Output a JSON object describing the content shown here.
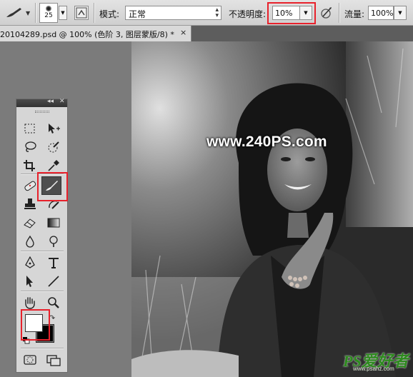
{
  "options_bar": {
    "brush_size": "25",
    "mode_label": "模式:",
    "mode_value": "正常",
    "opacity_label": "不透明度:",
    "opacity_value": "10%",
    "flow_label": "流量:",
    "flow_value": "100%"
  },
  "document_tab": {
    "title": "20104289.psd @ 100% (色阶 3, 图层蒙版/8) *",
    "close": "×"
  },
  "canvas": {
    "watermark": "www.240PS.com"
  },
  "site_logo": {
    "brand": "PS爱好者",
    "url": "www.psahz.com"
  },
  "tools_panel": {
    "collapse_glyph": "◂◂",
    "close_glyph": "✕",
    "foreground_color": "#ffffff",
    "background_color": "#000000",
    "tools": [
      "marquee-tool",
      "move-tool",
      "lasso-tool",
      "quick-selection-tool",
      "crop-tool",
      "eyedropper-tool",
      "healing-brush-tool",
      "brush-tool",
      "clone-stamp-tool",
      "history-brush-tool",
      "eraser-tool",
      "gradient-tool",
      "blur-tool",
      "dodge-tool",
      "pen-tool",
      "type-tool",
      "path-selection-tool",
      "line-tool",
      "hand-tool",
      "zoom-tool",
      "quick-mask-tool",
      "screen-mode-tool"
    ],
    "active_tool": "brush-tool"
  },
  "highlight_color": "#e8212b"
}
